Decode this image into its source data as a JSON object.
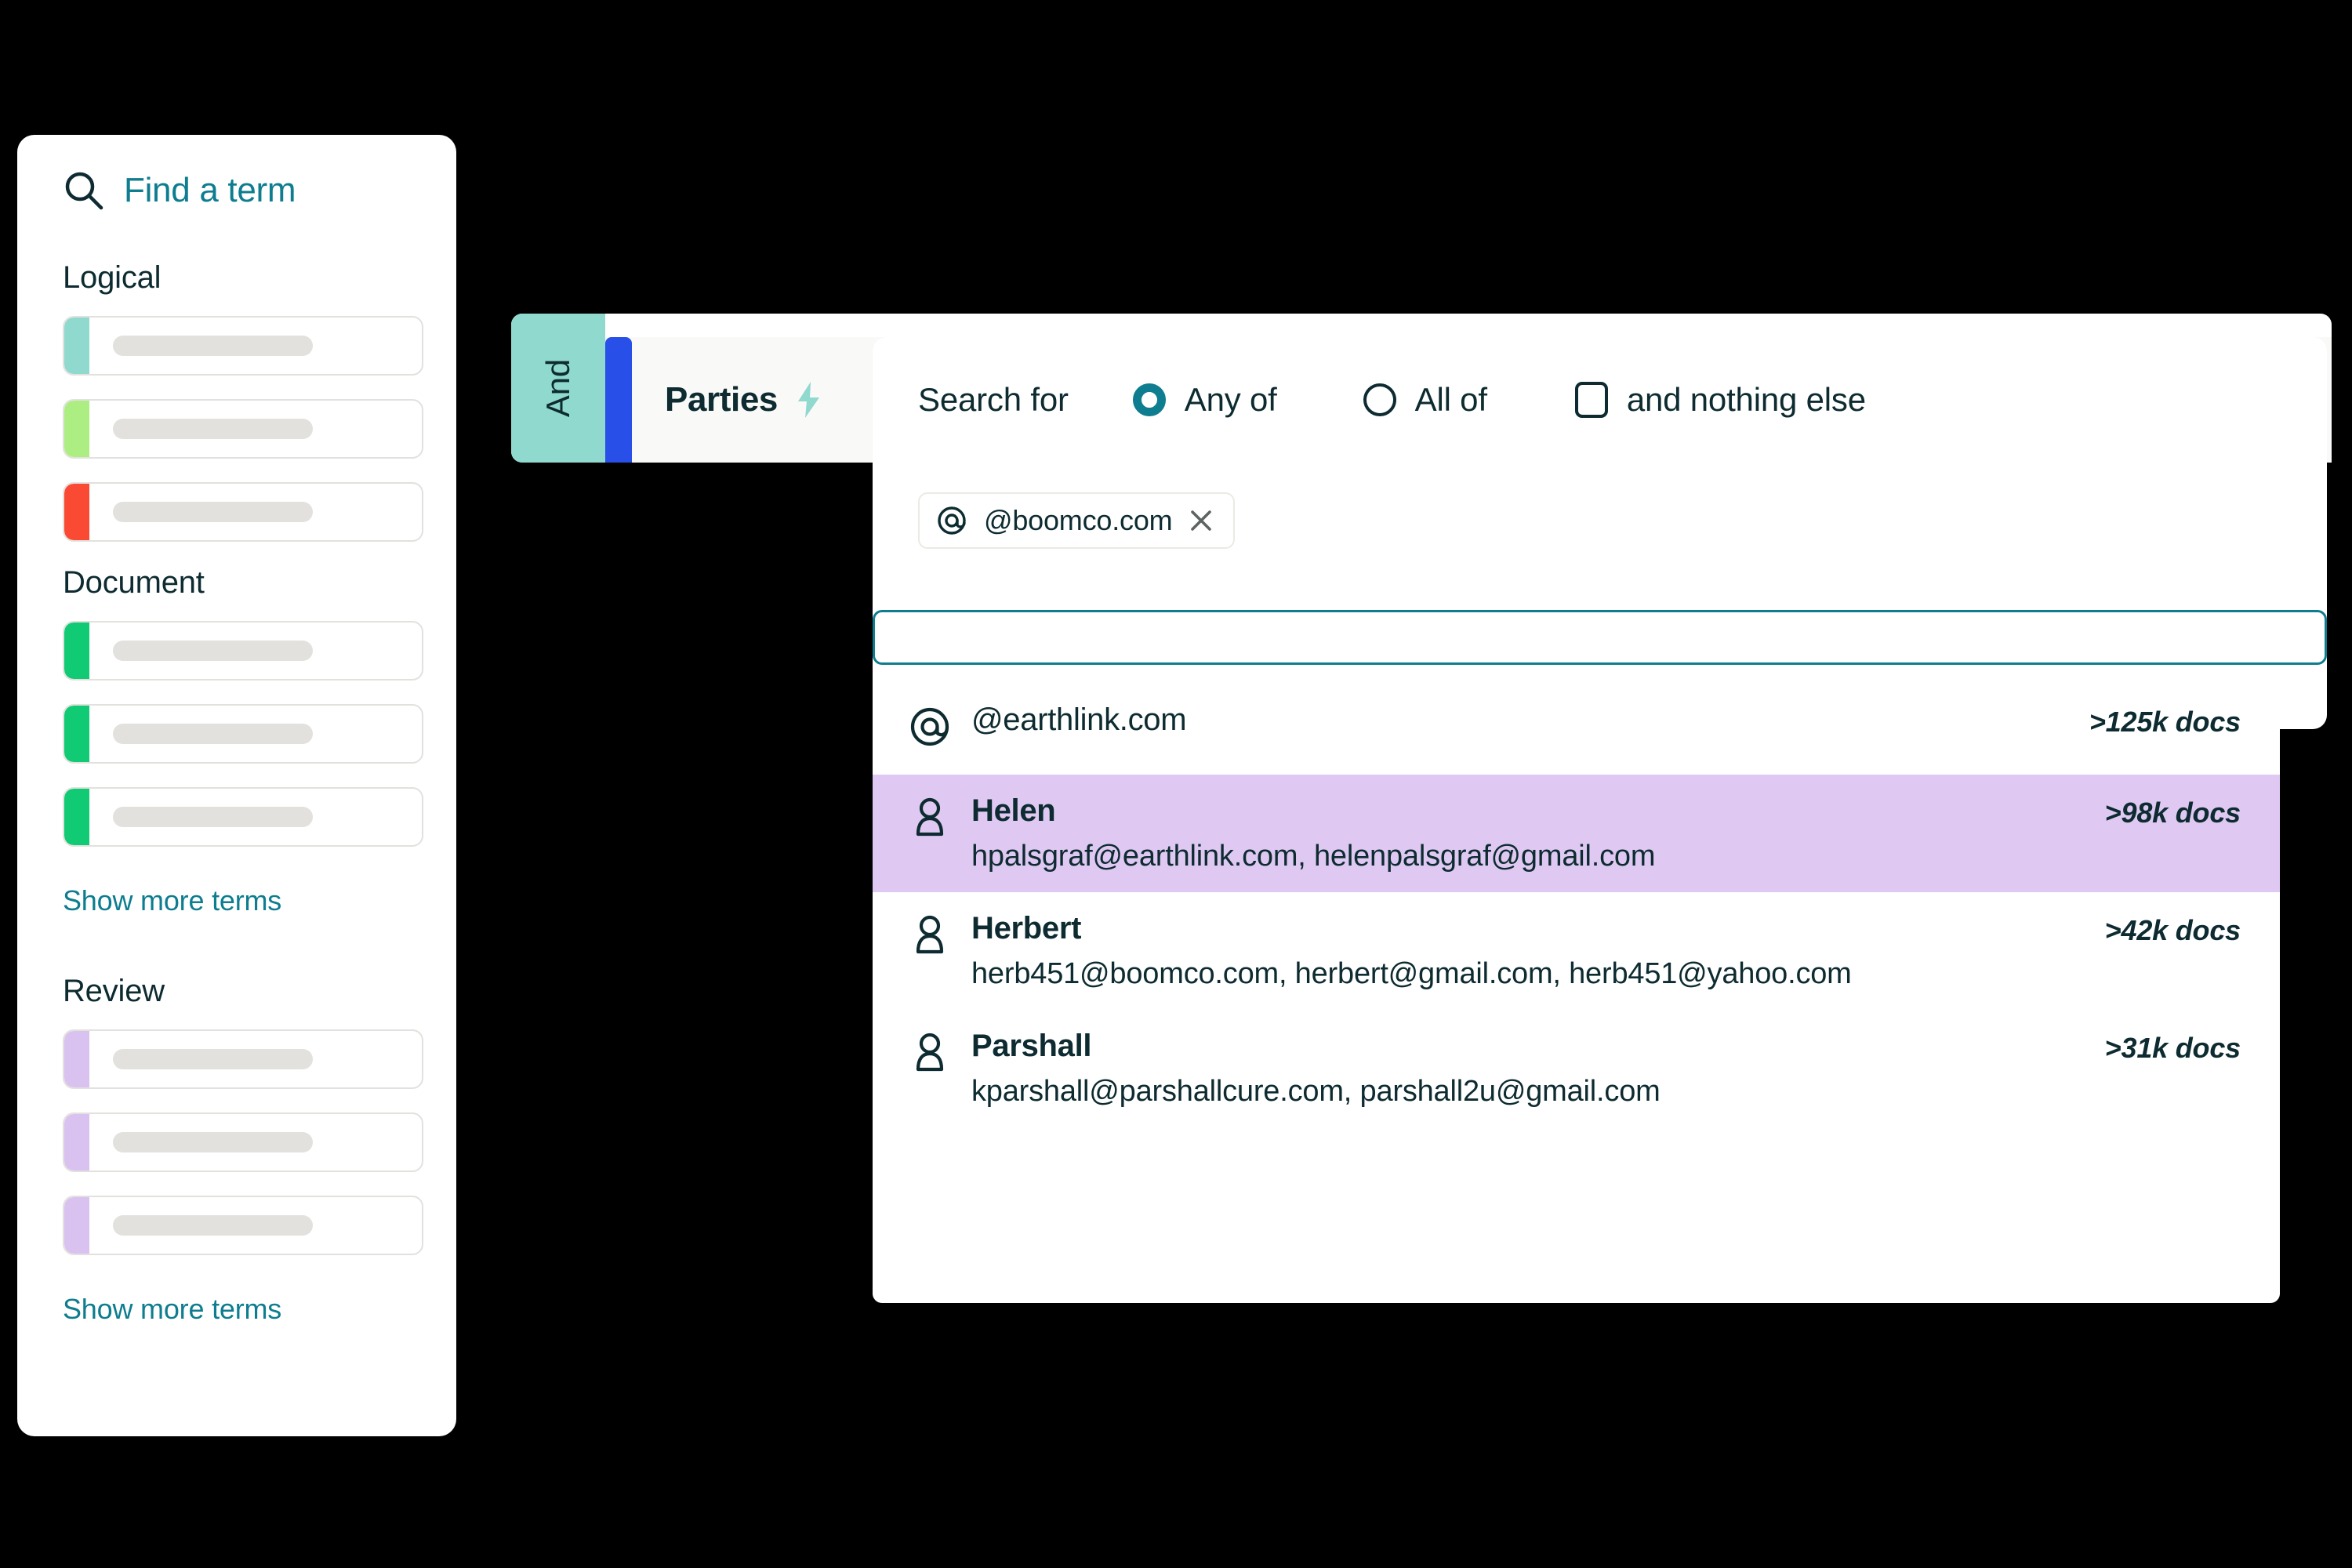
{
  "sidebar": {
    "search": {
      "label": "Find a term",
      "icon": "search-icon"
    },
    "groups": [
      {
        "title": "Logical",
        "terms": [
          {
            "color": "#8fd9ce"
          },
          {
            "color": "#adee83"
          },
          {
            "color": "#fb4a34"
          }
        ],
        "show_more": null
      },
      {
        "title": "Document",
        "terms": [
          {
            "color": "#10ca74"
          },
          {
            "color": "#10ca74"
          },
          {
            "color": "#10ca74"
          }
        ],
        "show_more": "Show more terms"
      },
      {
        "title": "Review",
        "terms": [
          {
            "color": "#d9c2f0"
          },
          {
            "color": "#d9c2f0"
          },
          {
            "color": "#d9c2f0"
          }
        ],
        "show_more": "Show more terms"
      }
    ]
  },
  "back_panel": {
    "operator_label": "And",
    "field_label": "Parties",
    "bolt_icon": "lightning-bolt-icon"
  },
  "search_panel": {
    "label": "Search for",
    "options": [
      {
        "label": "Any of",
        "type": "radio",
        "checked": true
      },
      {
        "label": "All of",
        "type": "radio",
        "checked": false
      },
      {
        "label": "and nothing else",
        "type": "checkbox",
        "checked": false
      }
    ],
    "chip": {
      "icon": "at-icon",
      "text": "@boomco.com",
      "remove_icon": "close-icon"
    },
    "input": {
      "value": "",
      "placeholder": ""
    }
  },
  "dropdown": {
    "results": [
      {
        "icon": "at-icon",
        "title": "@earthlink.com",
        "subtitle": "",
        "count": ">125k docs",
        "highlighted": false
      },
      {
        "icon": "person-icon",
        "title": "Helen",
        "subtitle": "hpalsgraf@earthlink.com, helenpalsgraf@gmail.com",
        "count": ">98k docs",
        "highlighted": true
      },
      {
        "icon": "person-icon",
        "title": "Herbert",
        "subtitle": "herb451@boomco.com, herbert@gmail.com, herb451@yahoo.com",
        "count": ">42k docs",
        "highlighted": false
      },
      {
        "icon": "person-icon",
        "title": "Parshall",
        "subtitle": "kparshall@parshallcure.com, parshall2u@gmail.com",
        "count": ">31k docs",
        "highlighted": false
      }
    ]
  },
  "colors": {
    "teal_accent": "#0d7d8f",
    "dark_text": "#0d2b30",
    "mint": "#8fd9ce",
    "blue_accent": "#2850e8",
    "highlight_purple": "#dfc9f2",
    "background": "#000000"
  }
}
